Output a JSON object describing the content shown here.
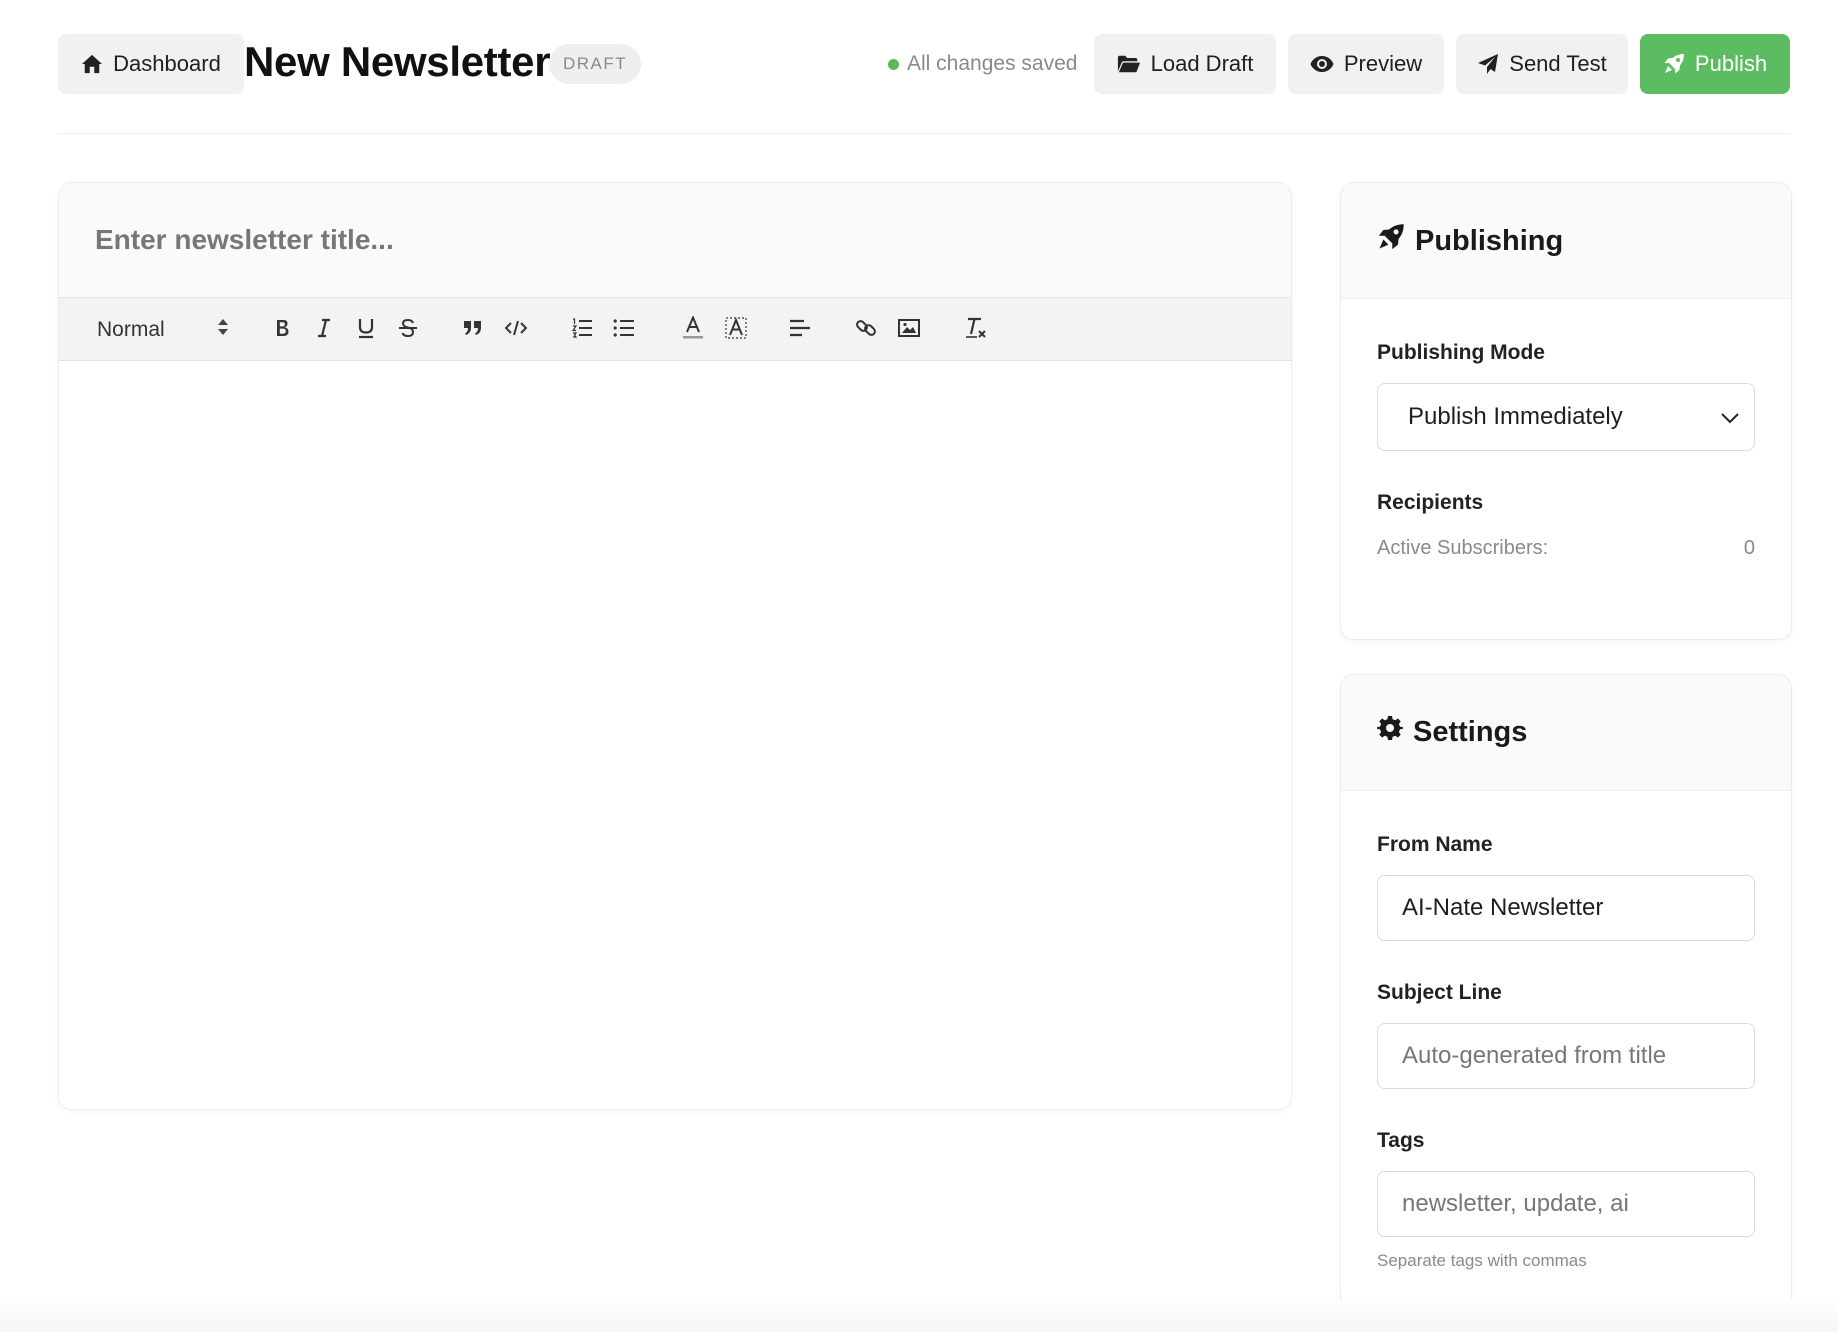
{
  "header": {
    "dashboard_label": "Dashboard",
    "title": "New Newsletter",
    "status_badge": "DRAFT",
    "save_status": "All changes saved",
    "load_draft_label": "Load Draft",
    "preview_label": "Preview",
    "send_test_label": "Send Test",
    "publish_label": "Publish"
  },
  "editor": {
    "title_placeholder": "Enter newsletter title...",
    "title_value": "",
    "format_select": "Normal",
    "toolbar": [
      "bold",
      "italic",
      "underline",
      "strikethrough",
      "blockquote",
      "code-block",
      "ordered-list",
      "bullet-list",
      "text-color",
      "background-color",
      "align",
      "link",
      "image",
      "clear-formatting"
    ],
    "body": ""
  },
  "publishing": {
    "title": "Publishing",
    "mode_label": "Publishing Mode",
    "mode_value": "Publish Immediately",
    "recipients_label": "Recipients",
    "active_subscribers_label": "Active Subscribers:",
    "active_subscribers_count": "0"
  },
  "settings": {
    "title": "Settings",
    "from_name_label": "From Name",
    "from_name_value": "AI-Nate Newsletter",
    "subject_label": "Subject Line",
    "subject_placeholder": "Auto-generated from title",
    "tags_label": "Tags",
    "tags_placeholder": "newsletter, update, ai",
    "tags_help": "Separate tags with commas"
  },
  "colors": {
    "publish_button": "#5cbc61",
    "save_indicator": "#5cb85c",
    "button_background": "#f1f1f3"
  }
}
